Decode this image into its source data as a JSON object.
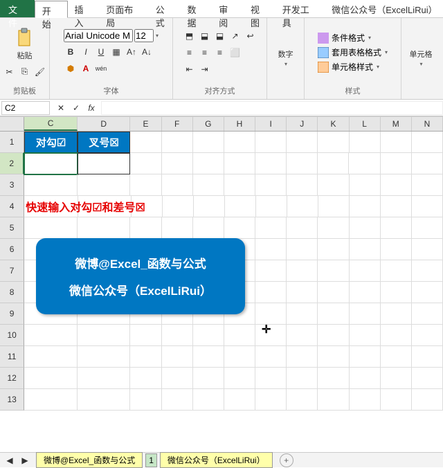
{
  "menu": {
    "file": "文件",
    "tabs": [
      "开始",
      "插入",
      "页面布局",
      "公式",
      "数据",
      "审阅",
      "视图",
      "开发工具",
      "微信公众号（ExcelLiRui）"
    ],
    "active": 0
  },
  "ribbon": {
    "clipboard": {
      "paste": "粘贴",
      "label": "剪贴板"
    },
    "font": {
      "name": "Arial Unicode M",
      "size": "12",
      "label": "字体"
    },
    "align": {
      "label": "对齐方式"
    },
    "number": {
      "btn": "数字",
      "label": ""
    },
    "styles": {
      "conditional": "条件格式",
      "table": "套用表格格式",
      "cell": "单元格样式",
      "label": "样式"
    },
    "cells": {
      "btn": "单元格"
    }
  },
  "namebox": "C2",
  "columns": [
    "C",
    "D",
    "E",
    "F",
    "G",
    "H",
    "I",
    "J",
    "K",
    "L",
    "M",
    "N"
  ],
  "row_numbers": [
    "1",
    "2",
    "3",
    "4",
    "5",
    "6",
    "7",
    "8",
    "9",
    "10",
    "11",
    "12",
    "13"
  ],
  "cells": {
    "c1": "对勾☑",
    "d1": "叉号☒",
    "c4": "快速输入对勾☑和差号☒"
  },
  "blue_box": {
    "line1": "微博@Excel_函数与公式",
    "line2": "微信公众号（ExcelLiRui）"
  },
  "sheets": {
    "s1": "微博@Excel_函数与公式",
    "s2": "1",
    "s3": "微信公众号（ExcelLiRui）"
  }
}
